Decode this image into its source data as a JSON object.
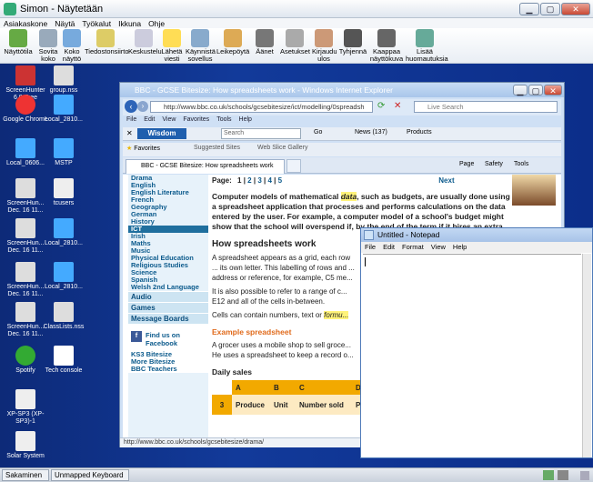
{
  "app": {
    "title": "Simon - Näytetään"
  },
  "menu": [
    "Asiakaskone",
    "Näytä",
    "Työkalut",
    "Ikkuna",
    "Ohje"
  ],
  "toolbar": [
    {
      "label": "Näyttötila",
      "icon": "display-mode-icon"
    },
    {
      "label": "Sovita koko",
      "icon": "fit-size-icon"
    },
    {
      "label": "Koko näyttö",
      "icon": "fullscreen-icon"
    },
    {
      "label": "Tiedostonsiirto",
      "icon": "file-transfer-icon"
    },
    {
      "label": "Keskustelu",
      "icon": "chat-icon"
    },
    {
      "label": "Lähetä viesti",
      "icon": "send-message-icon"
    },
    {
      "label": "Käynnistä sovellus",
      "icon": "launch-app-icon"
    },
    {
      "label": "Leikepöytä",
      "icon": "clipboard-icon"
    },
    {
      "label": "Äänet",
      "icon": "microphone-icon"
    },
    {
      "label": "Asetukset",
      "icon": "settings-icon"
    },
    {
      "label": "Kirjaudu ulos",
      "icon": "logout-icon"
    },
    {
      "label": "Tyhjennä",
      "icon": "clear-screen-icon"
    },
    {
      "label": "Kaappaa näyttökuva",
      "icon": "camera-icon"
    },
    {
      "label": "Lisää huomautuksia",
      "icon": "annotate-icon"
    }
  ],
  "desktop_icons": [
    {
      "label": "ScreenHunter 6.0 Free"
    },
    {
      "label": "group.nss"
    },
    {
      "label": "Google Chrome"
    },
    {
      "label": "Local_2810..."
    },
    {
      "label": "Local_0606..."
    },
    {
      "label": "MSTP"
    },
    {
      "label": "ScreenHun... Dec. 16 11..."
    },
    {
      "label": "tcusers"
    },
    {
      "label": "ScreenHun... Dec. 16 11..."
    },
    {
      "label": "Local_2810..."
    },
    {
      "label": "ScreenHun... Dec. 16 11..."
    },
    {
      "label": "Local_2810..."
    },
    {
      "label": "ScreenHun... Dec. 16 11..."
    },
    {
      "label": "ClassLists.nss"
    },
    {
      "label": "Spotify"
    },
    {
      "label": "Tech console"
    },
    {
      "label": "XP-SP3 (XP-SP3)-1"
    },
    {
      "label": "Solar System"
    }
  ],
  "ie": {
    "title": "BBC - GCSE Bitesize: How spreadsheets work - Windows Internet Explorer",
    "address": "http://www.bbc.co.uk/schools/gcsebitesize/ict/modelling/0spreadsh",
    "search_placeholder": "Live Search",
    "menu": [
      "File",
      "Edit",
      "View",
      "Favorites",
      "Tools",
      "Help"
    ],
    "wisdom": {
      "search": "Search",
      "go": "Go",
      "news": "News (137)",
      "products": "Products"
    },
    "favorites": {
      "label": "Favorites",
      "suggested": "Suggested Sites",
      "webslice": "Web Slice Gallery"
    },
    "tab": "BBC - GCSE Bitesize: How spreadsheets work",
    "cmd": {
      "page": "Page",
      "safety": "Safety",
      "tools": "Tools"
    },
    "status_url": "http://www.bbc.co.uk/schools/gcsebitesize/drama/",
    "sidenav": [
      "Drama",
      "English",
      "English Literature",
      "French",
      "Geography",
      "German",
      "History",
      "ICT",
      "Irish",
      "Maths",
      "Music",
      "Physical Education",
      "Religious Studies",
      "Science",
      "Spanish",
      "Welsh 2nd Language"
    ],
    "sidenav_big": [
      "Audio",
      "Games",
      "Message Boards"
    ],
    "facebook": "Find us on Facebook",
    "links": [
      "KS3 Bitesize",
      "More Bitesize",
      "BBC Teachers"
    ],
    "page": {
      "label": "Page:",
      "pages": [
        "1",
        "2",
        "3",
        "4",
        "5"
      ],
      "next": "Next",
      "intro_a": "Computer models of mathematical ",
      "intro_data": "data",
      "intro_b": ", such as budgets, are usually done using a spreadsheet application that processes and performs calculations on the data entered by the user. For example, a computer model of a school's budget might show that the school will overspend if, by the end of the term if it hires an extra...",
      "h_how": "How spreadsheets work",
      "p1": "A spreadsheet appears as a grid, each row ... its own letter. This labelling of rows and ... address or reference, for example, C5 me...",
      "p2": "It is also possible to refer to a range of c... E12 and all of the cells in-between.",
      "p3a": "Cells can contain numbers, text or ",
      "p3b": "formu...",
      "h_example": "Example spreadsheet",
      "p4": "A grocer uses a mobile shop to sell groce... He uses a spreadsheet to keep a record o...",
      "h_daily": "Daily sales",
      "cols": [
        "A",
        "B",
        "C",
        "D"
      ],
      "row_num": "3",
      "row": [
        "Produce",
        "Unit",
        "Number sold",
        "P"
      ]
    }
  },
  "notepad": {
    "title": "Untitled - Notepad",
    "menu": [
      "File",
      "Edit",
      "Format",
      "View",
      "Help"
    ]
  },
  "taskbar": {
    "items": [
      "Sakaminen",
      "Unmapped Keyboard"
    ]
  }
}
